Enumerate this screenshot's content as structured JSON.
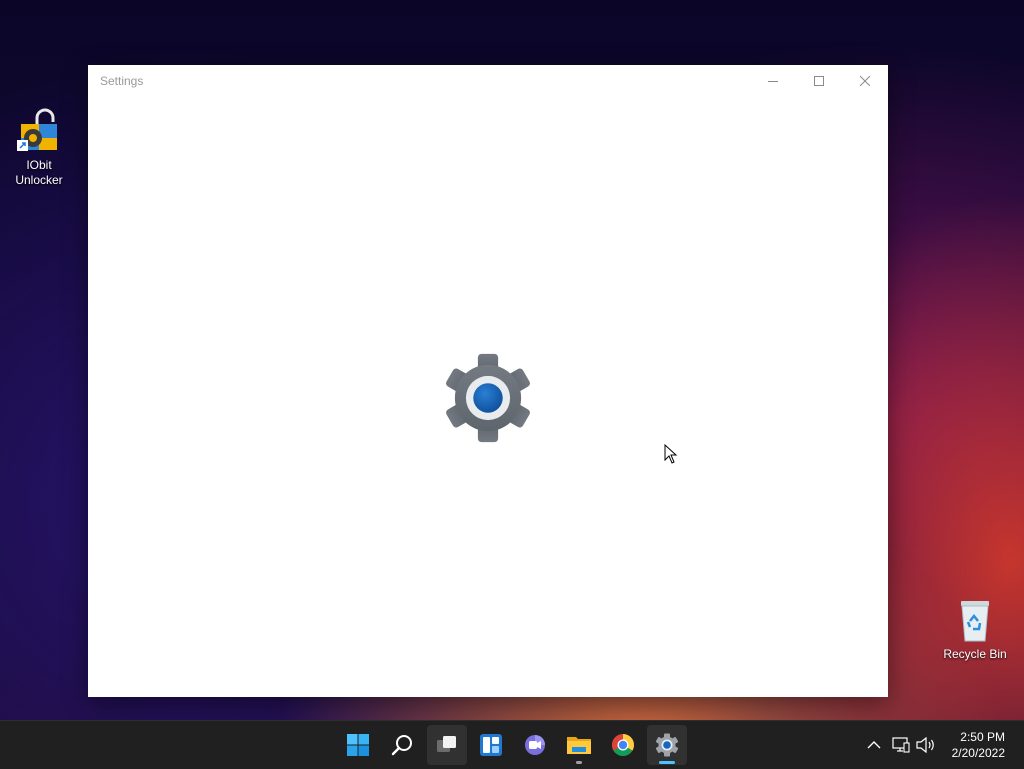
{
  "desktop": {
    "icons": [
      {
        "label": "IObit\nUnlocker",
        "icon": "iobit-unlocker-icon"
      },
      {
        "label": "Recycle Bin",
        "icon": "recycle-bin-icon"
      }
    ]
  },
  "window": {
    "title": "Settings",
    "controls": {
      "minimize": "minimize-icon",
      "maximize": "maximize-icon",
      "close": "close-icon"
    },
    "splash_icon": "settings-gear-icon",
    "accent_color": "#0f5fb0"
  },
  "taskbar": {
    "apps": [
      {
        "name": "Start",
        "icon": "windows-start-icon"
      },
      {
        "name": "Search",
        "icon": "search-icon"
      },
      {
        "name": "Task View",
        "icon": "task-view-icon"
      },
      {
        "name": "Widgets",
        "icon": "widgets-icon"
      },
      {
        "name": "Chat",
        "icon": "teams-chat-icon"
      },
      {
        "name": "File Explorer",
        "icon": "file-explorer-icon"
      },
      {
        "name": "Google Chrome",
        "icon": "chrome-icon"
      },
      {
        "name": "Settings",
        "icon": "settings-icon"
      }
    ],
    "tray": {
      "chevron": "show-hidden-icons-chevron",
      "network": "network-icon",
      "volume": "volume-icon"
    },
    "clock": {
      "time": "2:50 PM",
      "date": "2/20/2022"
    }
  }
}
